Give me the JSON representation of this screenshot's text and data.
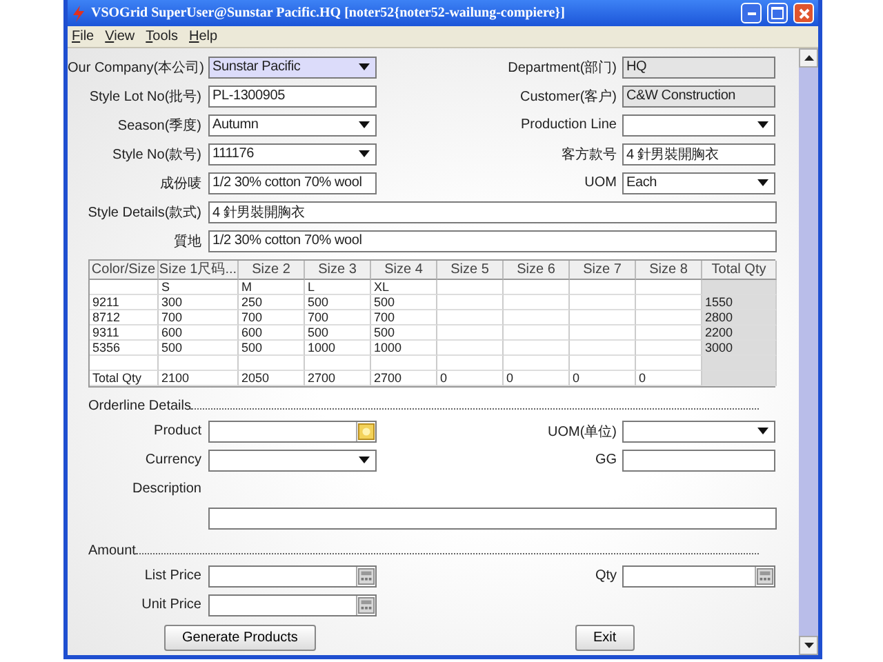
{
  "window": {
    "title": "VSOGrid  SuperUser@Sunstar Pacific.HQ [noter52{noter52-wailung-compiere}]"
  },
  "menu": [
    {
      "label": "File"
    },
    {
      "label": "View"
    },
    {
      "label": "Tools"
    },
    {
      "label": "Help"
    }
  ],
  "header_rows": [
    {
      "left": {
        "label": "Our Company(本公司)",
        "value": "Sunstar Pacific",
        "kind": "dropdown",
        "focused": true
      },
      "right": {
        "label": "Department(部门)",
        "value": "HQ",
        "kind": "readonly"
      }
    },
    {
      "left": {
        "label": "Style Lot No(批号)",
        "value": "PL-1300905",
        "kind": "text",
        "focused": false
      },
      "right": {
        "label": "Customer(客户)",
        "value": "C&W Construction",
        "kind": "readonly"
      }
    },
    {
      "left": {
        "label": "Season(季度)",
        "value": "Autumn",
        "kind": "dropdown",
        "focused": false
      },
      "right": {
        "label": "Production Line",
        "kind": "dropdown",
        "focused": false
      }
    },
    {
      "left": {
        "label": "Style No(款号)",
        "value": "111176",
        "kind": "dropdown",
        "focused": false
      },
      "right": {
        "label": "客方款号",
        "value": "4 針男裝開胸衣",
        "kind": "text",
        "focused": false
      }
    },
    {
      "left": {
        "label": "成份唛",
        "value": "1/2 30% cotton 70% wool",
        "kind": "text",
        "focused": false
      },
      "right": {
        "label": "UOM",
        "value": "Each",
        "kind": "dropdown",
        "focused": false
      }
    },
    {
      "wide": {
        "label": "Style Details(款式)",
        "value": "4 針男裝開胸衣",
        "focused": false
      }
    },
    {
      "wide": {
        "label": "質地",
        "value": "1/2 30% cotton 70% wool",
        "focused": false
      }
    }
  ],
  "table": {
    "columns": [
      "Color/Size",
      "Size 1尺码...",
      "Size 2",
      "Size 3",
      "Size 4",
      "Size 5",
      "Size 6",
      "Size 7",
      "Size 8",
      "Total Qty"
    ],
    "rows": [
      [
        null,
        "S",
        "M",
        "L",
        "XL",
        null,
        null,
        null,
        null,
        null
      ],
      [
        "9211",
        "300",
        "250",
        "500",
        "500",
        null,
        null,
        null,
        null,
        "1550"
      ],
      [
        "8712",
        "700",
        "700",
        "700",
        "700",
        null,
        null,
        null,
        null,
        "2800"
      ],
      [
        "9311",
        "600",
        "600",
        "500",
        "500",
        null,
        null,
        null,
        null,
        "2200"
      ],
      [
        "5356",
        "500",
        "500",
        "1000",
        "1000",
        null,
        null,
        null,
        null,
        "3000"
      ],
      [
        null,
        null,
        null,
        null,
        null,
        null,
        null,
        null,
        null,
        null
      ],
      [
        "Total Qty",
        "2100",
        "2050",
        "2700",
        "2700",
        "0",
        "0",
        "0",
        "0",
        null
      ]
    ]
  },
  "orderline": {
    "title": "Orderline Details",
    "rows": [
      {
        "left": {
          "label": "Product",
          "kind": "lookup"
        },
        "right": {
          "label": "UOM(单位)",
          "kind": "dropdown"
        }
      },
      {
        "left": {
          "label": "Currency",
          "kind": "dropdown"
        },
        "right": {
          "label": "GG",
          "kind": "text"
        }
      }
    ],
    "description": {
      "label": "Description"
    }
  },
  "amount": {
    "title": "Amount",
    "rows": [
      {
        "left": {
          "label": "List Price",
          "kind": "number"
        },
        "right": {
          "label": "Qty",
          "kind": "number"
        }
      },
      {
        "left": {
          "label": "Unit Price",
          "kind": "number"
        }
      }
    ]
  },
  "buttons": [
    "Generate Products",
    "Exit"
  ]
}
